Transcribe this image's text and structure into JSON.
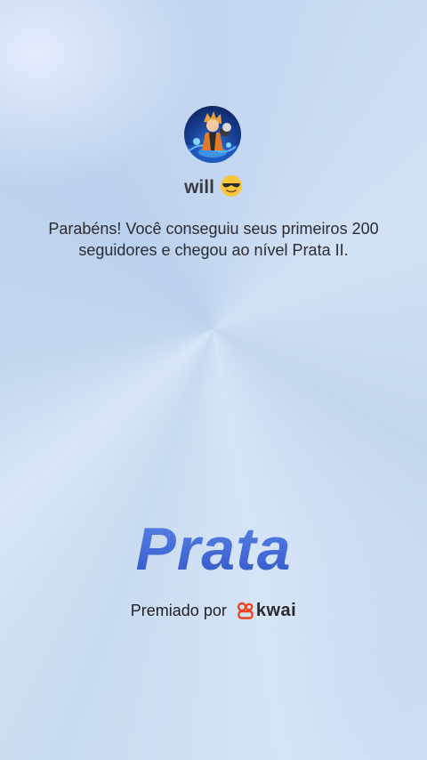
{
  "profile": {
    "username": "will",
    "emoji_icon": "sunglasses-smiling-face-icon",
    "avatar_icon": "anime-character-avatar"
  },
  "message": "Parabéns! Você conseguiu seus primeiros 200 seguidores e chegou ao nível Prata II.",
  "level": {
    "title": "Prata"
  },
  "awarded": {
    "prefix": "Premiado por",
    "brand": "kwai",
    "brand_icon": "kwai-logo-icon",
    "brand_color": "#f0441c"
  },
  "colors": {
    "level_text": "#3f6bd6",
    "background": "#c9dbf1"
  }
}
